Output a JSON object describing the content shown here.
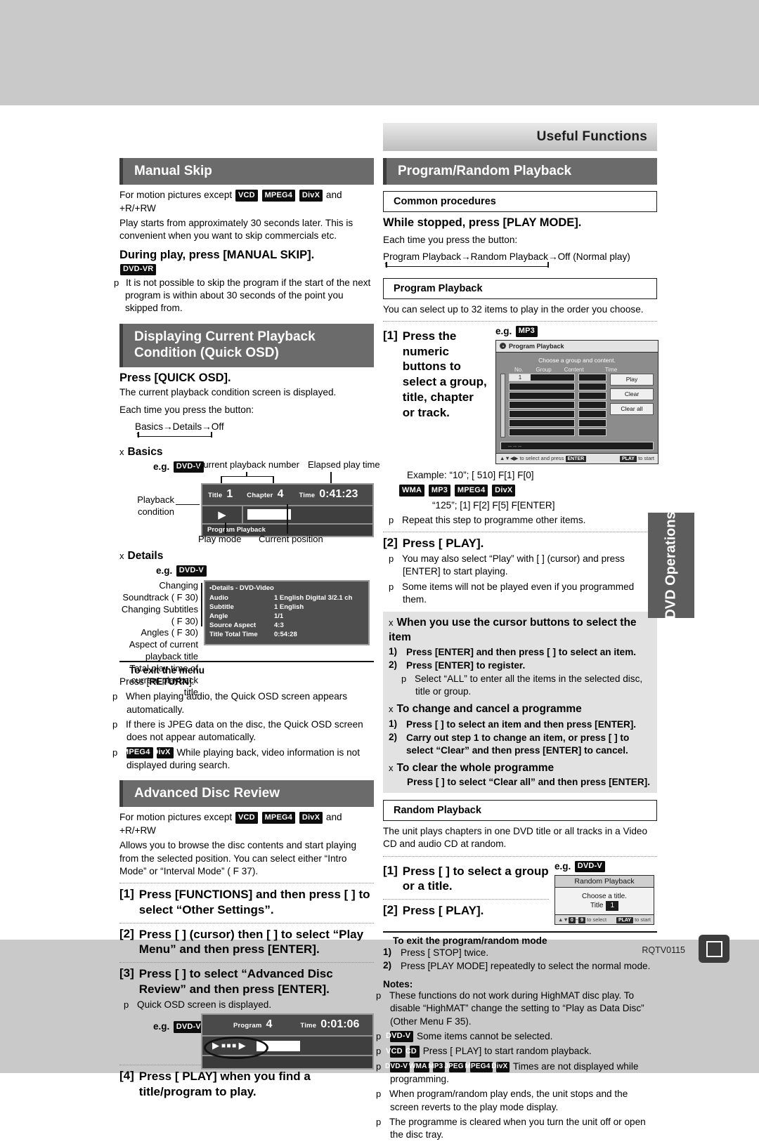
{
  "page": {
    "running_head": "Useful Functions",
    "side_tab": "DVD Operations",
    "doc_code": "RQTV0115"
  },
  "manual_skip": {
    "heading": "Manual Skip",
    "intro_prefix": "For motion pictures except",
    "tags": [
      "VCD",
      "MPEG4",
      "DivX"
    ],
    "intro_suffix": "and +R/+RW",
    "desc": "Play starts from approximately 30 seconds later. This is convenient when you want to skip commercials etc.",
    "action": "During play, press [MANUAL SKIP].",
    "tag_dvdvr": "DVD-VR",
    "note": "It is not possible to skip the program if the start of the next program is within about 30 seconds of the point you skipped from."
  },
  "quick_osd": {
    "heading": "Displaying Current Playback Condition (Quick OSD)",
    "action": "Press [QUICK OSD].",
    "desc": "The current playback condition screen is displayed.",
    "each_time": "Each time you press the button:",
    "cycle": "Basics→Details→Off",
    "basics": {
      "label": "Basics",
      "eg": "e.g.",
      "eg_tag": "DVD-V",
      "callout_number": "Current playback number",
      "callout_elapsed": "Elapsed play time",
      "callout_condition": "Playback condition",
      "callout_playmode": "Play mode",
      "callout_position": "Current position",
      "screen": {
        "title_label": "Title",
        "title_value": "1",
        "chapter_label": "Chapter",
        "chapter_value": "4",
        "time_label": "Time",
        "time_value": "0:41:23",
        "play_mode": "Program Playback"
      }
    },
    "details": {
      "label": "Details",
      "eg": "e.g.",
      "eg_tag": "DVD-V",
      "callouts": [
        "Changing Soundtrack ( F 30)",
        "Changing Subtitles ( F 30)",
        "Angles ( F 30)",
        "Aspect of current playback title",
        "Total play time of current playback title"
      ],
      "screen": {
        "title": "Details - DVD-Video",
        "rows": [
          {
            "k": "Audio",
            "v": "1 English  Digital 3/2.1 ch"
          },
          {
            "k": "Subtitle",
            "v": "1 English"
          },
          {
            "k": "Angle",
            "v": "1/1"
          },
          {
            "k": "Source Aspect",
            "v": "4:3"
          },
          {
            "k": "Title Total Time",
            "v": "0:54:28"
          }
        ]
      }
    },
    "exit_heading": "To exit the menu",
    "exit_text_pre": "Press [",
    "exit_key": "RETURN",
    "exit_text_post": "].",
    "notes": [
      "When playing audio, the Quick OSD screen appears automatically.",
      "If there is JPEG data on the disc, the Quick OSD screen does not appear automatically."
    ],
    "note_tagged": {
      "tags": [
        "MPEG4",
        "DivX"
      ],
      "text": "While playing back, video information is not displayed during search."
    }
  },
  "advanced_disc_review": {
    "heading": "Advanced Disc Review",
    "intro_prefix": "For motion pictures except",
    "tags": [
      "VCD",
      "MPEG4",
      "DivX"
    ],
    "intro_suffix": "and +R/+RW",
    "desc": "Allows you to browse the disc contents and start playing from the selected position. You can select either “Intro Mode” or “Interval Mode” ( F 37).",
    "steps": [
      {
        "num": "[1]",
        "text": "Press [FUNCTIONS] and then press [      ] to select “Other Settings”."
      },
      {
        "num": "[2]",
        "text": "Press [    ] (cursor) then [     ] to select “Play Menu” and then press [ENTER]."
      },
      {
        "num": "[3]",
        "text": "Press [      ] to select “Advanced Disc Review” and then press [ENTER]."
      },
      {
        "num": "[4]",
        "text": "Press [  PLAY] when you find a title/program to play."
      }
    ],
    "step3_note": "Quick OSD screen is displayed.",
    "eg": "e.g.",
    "eg_tag": "DVD-VR",
    "screen": {
      "program_label": "Program",
      "program_value": "4",
      "time_label": "Time",
      "time_value": "0:01:06"
    }
  },
  "program_random": {
    "heading": "Program/Random Playback",
    "common_procedures": "Common procedures",
    "while_stopped": "While stopped, press [PLAY MODE].",
    "each_time": "Each time you press the button:",
    "cycle": "Program Playback→Random Playback→Off (Normal play)"
  },
  "program_playback": {
    "box_title": "Program Playback",
    "desc": "You can select up to 32 items to play in the order you choose.",
    "step1_num": "[1]",
    "step1_text": "Press the numeric buttons to select a group, title, chapter or track.",
    "eg": "e.g.",
    "eg_tag": "MP3",
    "dialog": {
      "title": "Program Playback",
      "subtitle": "Choose a group and content.",
      "columns": [
        "No.",
        "Group",
        "Content",
        "Time"
      ],
      "first_row_no": "1",
      "buttons": [
        "Play",
        "Clear",
        "Clear all"
      ],
      "msg": "-- -- --",
      "foot_left": "to select and press",
      "foot_left_key": "ENTER",
      "foot_right_key": "PLAY",
      "foot_right": "to start"
    },
    "example_line1": "Example: “10”;  [ 510] F[1] F[0]",
    "example_tags": [
      "WMA",
      "MP3",
      "MPEG4",
      "DivX"
    ],
    "example_line2": "“125”; [1] F[2] F[5] F[ENTER]",
    "repeat_note": "Repeat this step to programme other items.",
    "step2_num": "[2]",
    "step2_text": "Press [  PLAY].",
    "step2_notes": [
      "You may also select “Play” with [   ] (cursor) and press [ENTER] to start playing.",
      "Some items will not be played even if you programmed them."
    ],
    "cursor_section": {
      "heading": "When you use the cursor buttons to select the item",
      "items": [
        {
          "n": "1)",
          "t": "Press [ENTER] and then press [      ] to select an item."
        },
        {
          "n": "2)",
          "t": "Press [ENTER] to register."
        }
      ],
      "note": "Select “ALL” to enter all the items in the selected disc, title or group."
    },
    "change_section": {
      "heading": "To change and cancel a programme",
      "items": [
        {
          "n": "1)",
          "t": "Press [      ] to select an item and then press [ENTER]."
        },
        {
          "n": "2)",
          "t": "Carry out step 1 to change an item, or press [      ] to select “Clear” and then press [ENTER] to cancel."
        }
      ]
    },
    "clear_section": {
      "heading": "To clear the whole programme",
      "text": "Press [      ] to select “Clear all” and then press [ENTER]."
    }
  },
  "random_playback": {
    "box_title": "Random Playback",
    "desc": "The unit plays chapters in one DVD title or all tracks in a Video CD and audio CD at random.",
    "step1_num": "[1]",
    "step1_text": "Press [      ] to select a group or a title.",
    "step2_num": "[2]",
    "step2_text": "Press [  PLAY].",
    "eg": "e.g.",
    "eg_tag": "DVD-V",
    "dialog": {
      "title": "Random Playback",
      "line1": "Choose a title.",
      "line2_label": "Title",
      "line2_value": "1",
      "foot_left": "to select",
      "foot_right_key": "PLAY",
      "foot_right": "to start"
    },
    "exit_heading": "To exit the program/random mode",
    "exit_items": [
      {
        "n": "1)",
        "t": "Press [ STOP] twice."
      },
      {
        "n": "2)",
        "t": "Press [PLAY MODE] repeatedly to select the normal mode."
      }
    ]
  },
  "notes": {
    "heading": "Notes:",
    "items": [
      {
        "tags": [],
        "text": "These functions do not work during HighMAT disc play. To disable “HighMAT” change the setting to “Play as Data Disc” (Other Menu  F 35)."
      },
      {
        "tags": [
          "DVD-V"
        ],
        "text": "Some items cannot be selected."
      },
      {
        "tags": [
          "VCD",
          "CD"
        ],
        "text": "Press [  PLAY] to start random playback."
      },
      {
        "tags": [
          "DVD-V",
          "WMA",
          "MP3",
          "JPEG",
          "MPEG4",
          "DivX"
        ],
        "text": "Times are not displayed while programming."
      },
      {
        "tags": [],
        "text": "When program/random play ends, the unit stops and the screen reverts to the play mode display."
      },
      {
        "tags": [],
        "text": "The programme is cleared when you turn the unit off or open the disc tray."
      }
    ]
  }
}
